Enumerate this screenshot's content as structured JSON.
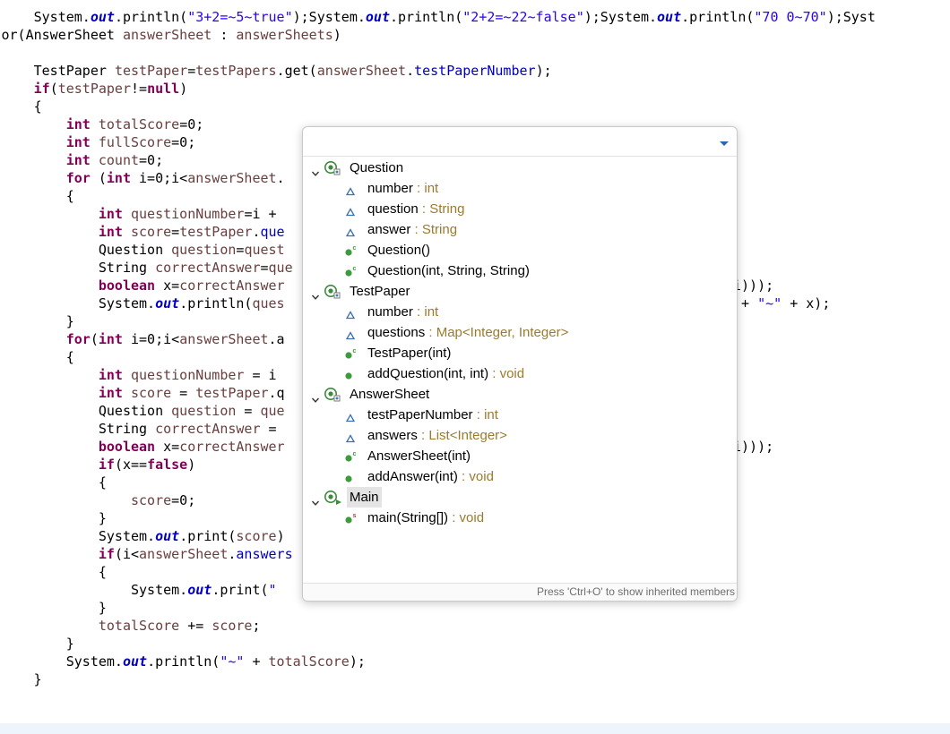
{
  "editor": {
    "lines": [
      [
        [
          "",
          "    System."
        ],
        [
          "static",
          "out"
        ],
        [
          "",
          ".println("
        ],
        [
          "str",
          "\"3+2=~5~true\""
        ],
        [
          "",
          ");System."
        ],
        [
          "static",
          "out"
        ],
        [
          "",
          ".println("
        ],
        [
          "str",
          "\"2+2=~22~false\""
        ],
        [
          "",
          ");System."
        ],
        [
          "static",
          "out"
        ],
        [
          "",
          ".println("
        ],
        [
          "str",
          "\"70 0~70\""
        ],
        [
          "",
          ");Syst"
        ]
      ],
      [
        [
          "",
          "or(AnswerSheet "
        ],
        [
          "var",
          "answerSheet"
        ],
        [
          "",
          " : "
        ],
        [
          "var",
          "answerSheets"
        ],
        [
          "",
          ")"
        ]
      ],
      [],
      [
        [
          "",
          "    TestPaper "
        ],
        [
          "var",
          "testPaper"
        ],
        [
          "",
          "="
        ],
        [
          "var",
          "testPapers"
        ],
        [
          "",
          ".get("
        ],
        [
          "var",
          "answerSheet"
        ],
        [
          "",
          "."
        ],
        [
          "field",
          "testPaperNumber"
        ],
        [
          "",
          ");"
        ]
      ],
      [
        [
          "",
          "    "
        ],
        [
          "kw",
          "if"
        ],
        [
          "",
          "("
        ],
        [
          "var",
          "testPaper"
        ],
        [
          "",
          "!="
        ],
        [
          "kw",
          "null"
        ],
        [
          "",
          ")"
        ]
      ],
      [
        [
          "",
          "    {"
        ]
      ],
      [
        [
          "",
          "        "
        ],
        [
          "kw",
          "int"
        ],
        [
          "",
          " "
        ],
        [
          "var",
          "totalScore"
        ],
        [
          "",
          "=0;"
        ]
      ],
      [
        [
          "",
          "        "
        ],
        [
          "kw",
          "int"
        ],
        [
          "",
          " "
        ],
        [
          "var",
          "fullScore"
        ],
        [
          "",
          "=0;"
        ]
      ],
      [
        [
          "",
          "        "
        ],
        [
          "kw",
          "int"
        ],
        [
          "",
          " "
        ],
        [
          "var",
          "count"
        ],
        [
          "",
          "=0;"
        ]
      ],
      [
        [
          "",
          "        "
        ],
        [
          "kw",
          "for"
        ],
        [
          "",
          " ("
        ],
        [
          "kw",
          "int"
        ],
        [
          "",
          " i=0;i<"
        ],
        [
          "var",
          "answerSheet"
        ],
        [
          "",
          "."
        ]
      ],
      [
        [
          "",
          "        {"
        ]
      ],
      [
        [
          "",
          "            "
        ],
        [
          "kw",
          "int"
        ],
        [
          "",
          " "
        ],
        [
          "var",
          "questionNumber"
        ],
        [
          "",
          "=i +"
        ]
      ],
      [
        [
          "",
          "            "
        ],
        [
          "kw",
          "int"
        ],
        [
          "",
          " "
        ],
        [
          "var",
          "score"
        ],
        [
          "",
          "="
        ],
        [
          "var",
          "testPaper"
        ],
        [
          "",
          "."
        ],
        [
          "field",
          "que"
        ]
      ],
      [
        [
          "",
          "            Question "
        ],
        [
          "var",
          "question"
        ],
        [
          "",
          "="
        ],
        [
          "var",
          "quest"
        ]
      ],
      [
        [
          "",
          "            String "
        ],
        [
          "var",
          "correctAnswer"
        ],
        [
          "",
          "="
        ],
        [
          "var",
          "que"
        ]
      ],
      [
        [
          "",
          "            "
        ],
        [
          "kw",
          "boolean"
        ],
        [
          "",
          " x="
        ],
        [
          "var",
          "correctAnswer"
        ]
      ],
      [
        [
          "",
          "            System."
        ],
        [
          "static",
          "out"
        ],
        [
          "",
          ".println("
        ],
        [
          "var",
          "ques"
        ]
      ],
      [
        [
          "",
          "        }"
        ]
      ],
      [
        [
          "",
          "        "
        ],
        [
          "kw",
          "for"
        ],
        [
          "",
          "("
        ],
        [
          "kw",
          "int"
        ],
        [
          "",
          " i=0;i<"
        ],
        [
          "var",
          "answerSheet"
        ],
        [
          "",
          ".a"
        ]
      ],
      [
        [
          "",
          "        {"
        ]
      ],
      [
        [
          "",
          "            "
        ],
        [
          "kw",
          "int"
        ],
        [
          "",
          " "
        ],
        [
          "var",
          "questionNumber"
        ],
        [
          "",
          " = i"
        ]
      ],
      [
        [
          "",
          "            "
        ],
        [
          "kw",
          "int"
        ],
        [
          "",
          " "
        ],
        [
          "var",
          "score"
        ],
        [
          "",
          " = "
        ],
        [
          "var",
          "testPaper"
        ],
        [
          "",
          ".q"
        ]
      ],
      [
        [
          "",
          "            Question "
        ],
        [
          "var",
          "question"
        ],
        [
          "",
          " = "
        ],
        [
          "var",
          "que"
        ]
      ],
      [
        [
          "",
          "            String "
        ],
        [
          "var",
          "correctAnswer"
        ],
        [
          "",
          " ="
        ]
      ],
      [
        [
          "",
          "            "
        ],
        [
          "kw",
          "boolean"
        ],
        [
          "",
          " x="
        ],
        [
          "var",
          "correctAnswer"
        ]
      ],
      [
        [
          "",
          "            "
        ],
        [
          "kw",
          "if"
        ],
        [
          "",
          "(x=="
        ],
        [
          "kw",
          "false"
        ],
        [
          "",
          ")"
        ]
      ],
      [
        [
          "",
          "            {"
        ]
      ],
      [
        [
          "",
          "                "
        ],
        [
          "var",
          "score"
        ],
        [
          "",
          "=0;"
        ]
      ],
      [
        [
          "",
          "            }"
        ]
      ],
      [
        [
          "",
          "            System."
        ],
        [
          "static",
          "out"
        ],
        [
          "",
          ".print("
        ],
        [
          "var",
          "score"
        ],
        [
          "",
          ")"
        ]
      ],
      [
        [
          "",
          "            "
        ],
        [
          "kw",
          "if"
        ],
        [
          "",
          "(i<"
        ],
        [
          "var",
          "answerSheet"
        ],
        [
          "",
          "."
        ],
        [
          "field",
          "answers"
        ]
      ],
      [
        [
          "",
          "            {"
        ]
      ],
      [
        [
          "",
          "                System."
        ],
        [
          "static",
          "out"
        ],
        [
          "",
          ".print("
        ],
        [
          "str",
          "\""
        ]
      ],
      [
        [
          "",
          "            }"
        ]
      ],
      [
        [
          "",
          "            "
        ],
        [
          "var",
          "totalScore"
        ],
        [
          "",
          " += "
        ],
        [
          "var",
          "score"
        ],
        [
          "",
          ";"
        ]
      ],
      [
        [
          "",
          "        }"
        ]
      ],
      [
        [
          "",
          "        System."
        ],
        [
          "static",
          "out"
        ],
        [
          "",
          ".println("
        ],
        [
          "str",
          "\"~\""
        ],
        [
          "",
          " + "
        ],
        [
          "var",
          "totalScore"
        ],
        [
          "",
          ");"
        ]
      ],
      [
        [
          "",
          "    }"
        ]
      ]
    ],
    "tail_fragments": [
      [
        [
          "",
          "i)));"
        ]
      ],
      [
        [
          "",
          " + "
        ],
        [
          "str",
          "\"~\""
        ],
        [
          "",
          " + x);"
        ]
      ],
      [
        [
          "",
          "i)));"
        ]
      ]
    ]
  },
  "quick_outline": {
    "filter_value": "",
    "filter_placeholder": "",
    "menu_icon": "chevron-down-icon",
    "status": "Press 'Ctrl+O' to show inherited members",
    "items": [
      {
        "level": 0,
        "kind": "class",
        "label": "Question",
        "type": "",
        "expanded": true,
        "selected": false
      },
      {
        "level": 1,
        "kind": "field",
        "label": "number",
        "type": " : int"
      },
      {
        "level": 1,
        "kind": "field",
        "label": "question",
        "type": " : String"
      },
      {
        "level": 1,
        "kind": "field",
        "label": "answer",
        "type": " : String"
      },
      {
        "level": 1,
        "kind": "constructor",
        "label": "Question()",
        "type": ""
      },
      {
        "level": 1,
        "kind": "constructor",
        "label": "Question(int, String, String)",
        "type": ""
      },
      {
        "level": 0,
        "kind": "class",
        "label": "TestPaper",
        "type": "",
        "expanded": true,
        "selected": false
      },
      {
        "level": 1,
        "kind": "field",
        "label": "number",
        "type": " : int"
      },
      {
        "level": 1,
        "kind": "field",
        "label": "questions",
        "type": " : Map<Integer, Integer>"
      },
      {
        "level": 1,
        "kind": "constructor",
        "label": "TestPaper(int)",
        "type": ""
      },
      {
        "level": 1,
        "kind": "method",
        "label": "addQuestion(int, int)",
        "type": " : void"
      },
      {
        "level": 0,
        "kind": "class",
        "label": "AnswerSheet",
        "type": "",
        "expanded": true,
        "selected": false
      },
      {
        "level": 1,
        "kind": "field",
        "label": "testPaperNumber",
        "type": " : int"
      },
      {
        "level": 1,
        "kind": "field",
        "label": "answers",
        "type": " : List<Integer>"
      },
      {
        "level": 1,
        "kind": "constructor",
        "label": "AnswerSheet(int)",
        "type": ""
      },
      {
        "level": 1,
        "kind": "method",
        "label": "addAnswer(int)",
        "type": " : void"
      },
      {
        "level": 0,
        "kind": "main-class",
        "label": "Main",
        "type": "",
        "expanded": true,
        "selected": true
      },
      {
        "level": 1,
        "kind": "static-method",
        "label": "main(String[])",
        "type": " : void"
      }
    ]
  },
  "colors": {
    "keyword": "#7f0055",
    "field": "#0000c0",
    "string": "#2a00ff",
    "local_variable": "#6a3e3e",
    "type_suffix": "#9a7b2e",
    "public_member": "#3d9b3d",
    "field_icon": "#3a6fb0",
    "class_icon": "#3c8b3c",
    "selection": "#e4e4e4"
  }
}
